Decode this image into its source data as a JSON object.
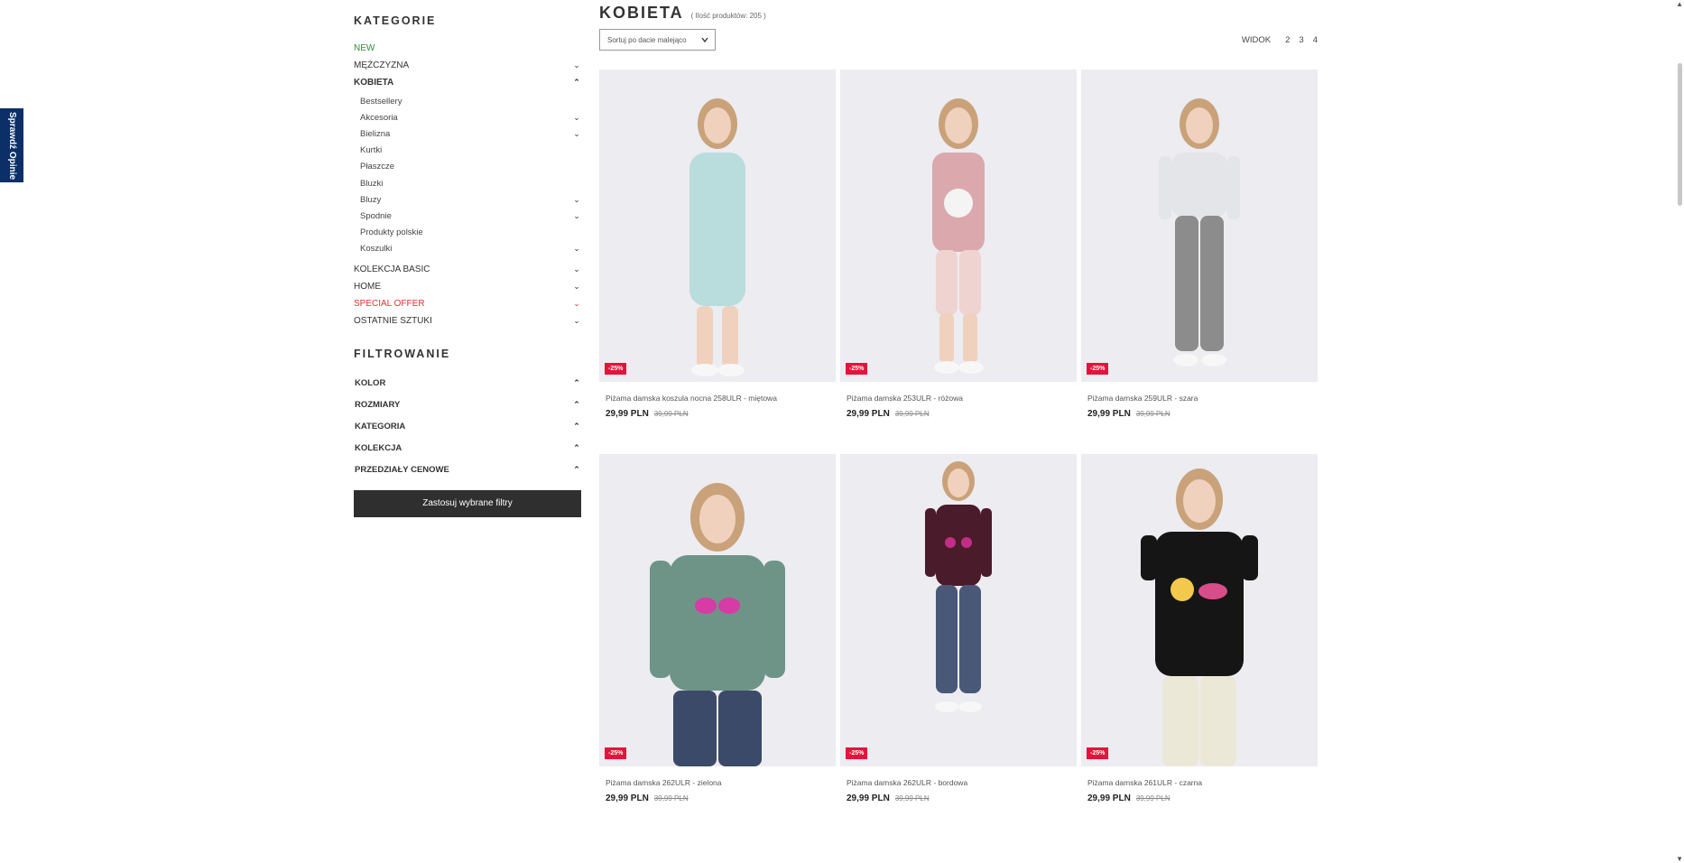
{
  "side_tab": {
    "label": "Sprawdź Opinie"
  },
  "sidebar": {
    "categories_heading": "KATEGORIE",
    "categories": [
      {
        "label": "NEW",
        "chevron": ""
      },
      {
        "label": "MĘŻCZYZNA",
        "chevron": "chevron-down"
      },
      {
        "label": "KOBIETA",
        "chevron": "chevron-up"
      }
    ],
    "subcategories": [
      {
        "label": "Bestsellery",
        "chevron": ""
      },
      {
        "label": "Akcesoria",
        "chevron": "chevron-down"
      },
      {
        "label": "Bielizna",
        "chevron": "chevron-down"
      },
      {
        "label": "Kurtki",
        "chevron": ""
      },
      {
        "label": "Płaszcze",
        "chevron": ""
      },
      {
        "label": "Bluzki",
        "chevron": ""
      },
      {
        "label": "Bluzy",
        "chevron": "chevron-down"
      },
      {
        "label": "Spodnie",
        "chevron": "chevron-down"
      },
      {
        "label": "Produkty polskie",
        "chevron": ""
      },
      {
        "label": "Koszulki",
        "chevron": "chevron-down"
      }
    ],
    "categories_after": [
      {
        "label": "KOLEKCJA BASIC",
        "chevron": "chevron-down"
      },
      {
        "label": "HOME",
        "chevron": "chevron-down"
      },
      {
        "label": "SPECIAL OFFER",
        "chevron": "chevron-down"
      },
      {
        "label": "OSTATNIE SZTUKI",
        "chevron": "chevron-down"
      }
    ],
    "filter_heading": "FILTROWANIE",
    "filters": [
      {
        "label": "KOLOR"
      },
      {
        "label": "ROZMIARY"
      },
      {
        "label": "KATEGORIA"
      },
      {
        "label": "KOLEKCJA"
      },
      {
        "label": "PRZEDZIAŁY CENOWE"
      }
    ],
    "apply_button": "Zastosuj wybrane filtry"
  },
  "main": {
    "title": "KOBIETA",
    "product_count": "( Ilość produktów: 205 )",
    "sort": {
      "selected": "Sortuj po dacie malejąco"
    },
    "view": {
      "label": "WIDOK",
      "options": [
        "2",
        "3",
        "4"
      ]
    }
  },
  "products": [
    {
      "name": "Piżama damska koszula nocna 258ULR - miętowa",
      "price": "29,99 PLN",
      "old_price": "39,99 PLN",
      "badge": "-25%",
      "shirt_color": "#b9dcdc",
      "bottom_color": "#b9dcdc"
    },
    {
      "name": "Piżama damska 253ULR - różowa",
      "price": "29,99 PLN",
      "old_price": "39,99 PLN",
      "badge": "-25%",
      "shirt_color": "#dba9ad",
      "bottom_color": "#efd3d1"
    },
    {
      "name": "Piżama damska 259ULR - szara",
      "price": "29,99 PLN",
      "old_price": "39,99 PLN",
      "badge": "-25%",
      "shirt_color": "#e3e5e8",
      "bottom_color": "#8c8c8c"
    },
    {
      "name": "Piżama damska 262ULR - zielona",
      "price": "29,99 PLN",
      "old_price": "39,99 PLN",
      "badge": "-25%",
      "shirt_color": "#6e9487",
      "bottom_color": "#3b4a68"
    },
    {
      "name": "Piżama damska 262ULR - bordowa",
      "price": "29,99 PLN",
      "old_price": "39,99 PLN",
      "badge": "-25%",
      "shirt_color": "#4a1b2a",
      "bottom_color": "#4a5878"
    },
    {
      "name": "Piżama damska 261ULR - czarna",
      "price": "29,99 PLN",
      "old_price": "39,99 PLN",
      "badge": "-25%",
      "shirt_color": "#151515",
      "bottom_color": "#ece8d8"
    }
  ],
  "colors": {
    "accent_new": "#2e8a3d",
    "accent_special": "#e03131",
    "badge": "#e5133a",
    "button_dark": "#2f2f2f",
    "side_tab": "#0b2f66"
  }
}
